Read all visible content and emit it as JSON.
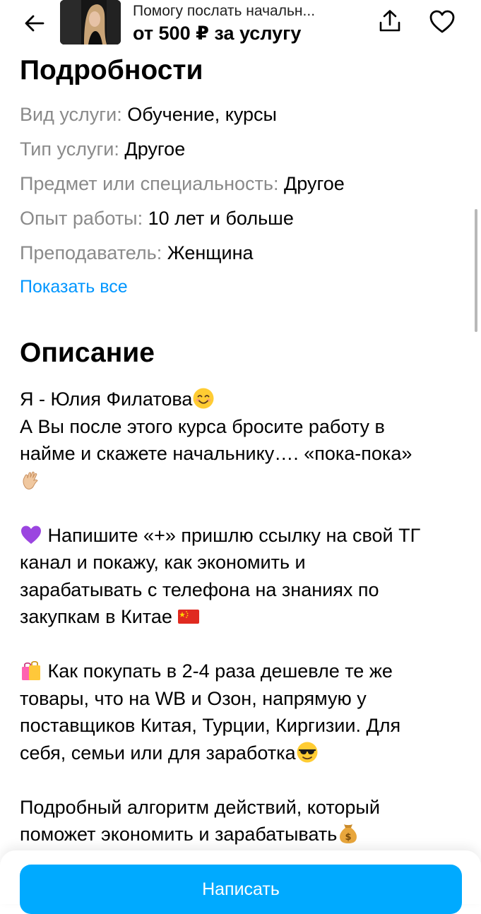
{
  "header": {
    "title": "Помогу послать начальн...",
    "price": "от 500 ₽ за услугу",
    "back_icon": "arrow-left-icon",
    "share_icon": "share-icon",
    "favorite_icon": "heart-icon"
  },
  "details": {
    "title": "Подробности",
    "rows": [
      {
        "key": "Вид услуги:",
        "value": "Обучение, курсы"
      },
      {
        "key": "Тип услуги:",
        "value": "Другое"
      },
      {
        "key": "Предмет или специальность:",
        "value": "Другое"
      },
      {
        "key": "Опыт работы:",
        "value": "10 лет и больше"
      },
      {
        "key": "Преподаватель:",
        "value": "Женщина"
      }
    ],
    "show_all": "Показать все"
  },
  "description": {
    "title": "Описание",
    "lines": [
      "Я - Юлия Филатова",
      "А Вы после этого курса бросите работу в",
      "найме и скажете начальнику…. «пока-пока»",
      "Напишите «+» пришлю ссылку на свой ТГ",
      "канал и покажу, как экономить и",
      "зарабатывать с телефона на знаниях по",
      "закупкам в Китае",
      "Как покупать в 2-4 раза дешевле те же",
      "товары, что на WB и Озон, напрямую у",
      "поставщиков Китая, Турции, Киргизии. Для",
      "себя, семьи или для заработка",
      "Подробный алгоритм действий, который",
      "поможет экономить и зарабатывать"
    ]
  },
  "bottom": {
    "write_label": "Написать"
  },
  "colors": {
    "accent": "#00aaff",
    "link": "#0096ff",
    "muted": "#8a8a8a"
  }
}
